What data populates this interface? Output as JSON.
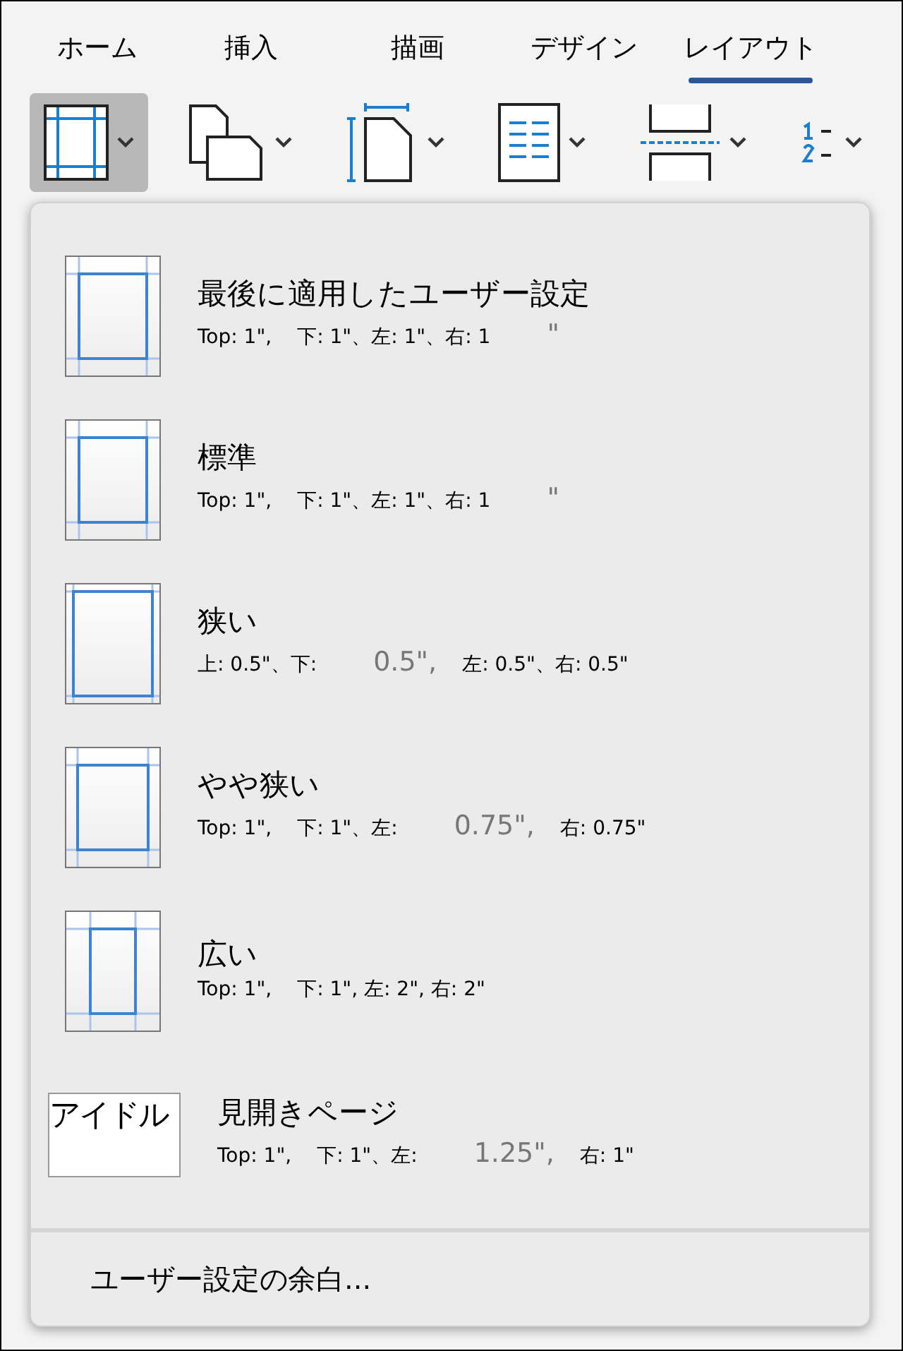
{
  "tabs": [
    {
      "label": "ホーム",
      "selected": false
    },
    {
      "label": "挿入",
      "selected": false
    },
    {
      "label": "描画",
      "selected": false
    },
    {
      "label": "デザイン",
      "selected": false
    },
    {
      "label": "レイアウト",
      "selected": true
    }
  ],
  "toolbar": [
    {
      "kind": "margins",
      "pressed": true
    },
    {
      "kind": "orientation",
      "pressed": false
    },
    {
      "kind": "size",
      "pressed": false
    },
    {
      "kind": "columns",
      "pressed": false
    },
    {
      "kind": "breaks",
      "pressed": false
    },
    {
      "kind": "line_numbers",
      "pressed": false
    }
  ],
  "margin_menu": {
    "items": [
      {
        "kind": "custom",
        "title": "最後に適用したユーザー設定",
        "detail": [
          {
            "text": "Top: 1\",",
            "faded": false
          },
          {
            "text": "下: 1\"、左: 1\"、右: 1",
            "faded": false
          },
          {
            "text": "\"",
            "faded": true
          }
        ]
      },
      {
        "kind": "normal",
        "title": "標準",
        "detail": [
          {
            "text": "Top: 1\",",
            "faded": false
          },
          {
            "text": "下: 1\"、左: 1\"、右: 1",
            "faded": false
          },
          {
            "text": "\"",
            "faded": true
          }
        ]
      },
      {
        "kind": "narrow",
        "title": "狭い",
        "detail": [
          {
            "text": "上: 0.5\"、下:",
            "faded": false
          },
          {
            "text": "0.5\",",
            "faded": true
          },
          {
            "text": "左: 0.5\"、右: 0.5\"",
            "faded": false
          }
        ]
      },
      {
        "kind": "moderate",
        "title": "やや狭い",
        "detail": [
          {
            "text": "Top: 1\",",
            "faded": false
          },
          {
            "text": "下: 1\"、左:",
            "faded": false
          },
          {
            "text": "0.75\",",
            "faded": true
          },
          {
            "text": "右: 0.75\"",
            "faded": false
          }
        ]
      },
      {
        "kind": "wide",
        "title": "広い",
        "detail": [
          {
            "text": "Top: 1\",",
            "faded": false
          },
          {
            "text": "下: 1\", 左: 2\", 右: 2\"",
            "faded": false
          }
        ]
      },
      {
        "kind": "broken",
        "icon_text": "アイドル",
        "title": "見開きページ",
        "detail": [
          {
            "text": "Top: 1\",",
            "faded": false
          },
          {
            "text": "下: 1\"、左:",
            "faded": false
          },
          {
            "text": "1.25\",",
            "faded": true
          },
          {
            "text": "右: 1\"",
            "faded": false
          }
        ]
      }
    ],
    "footer": "ユーザー設定の余白..."
  }
}
